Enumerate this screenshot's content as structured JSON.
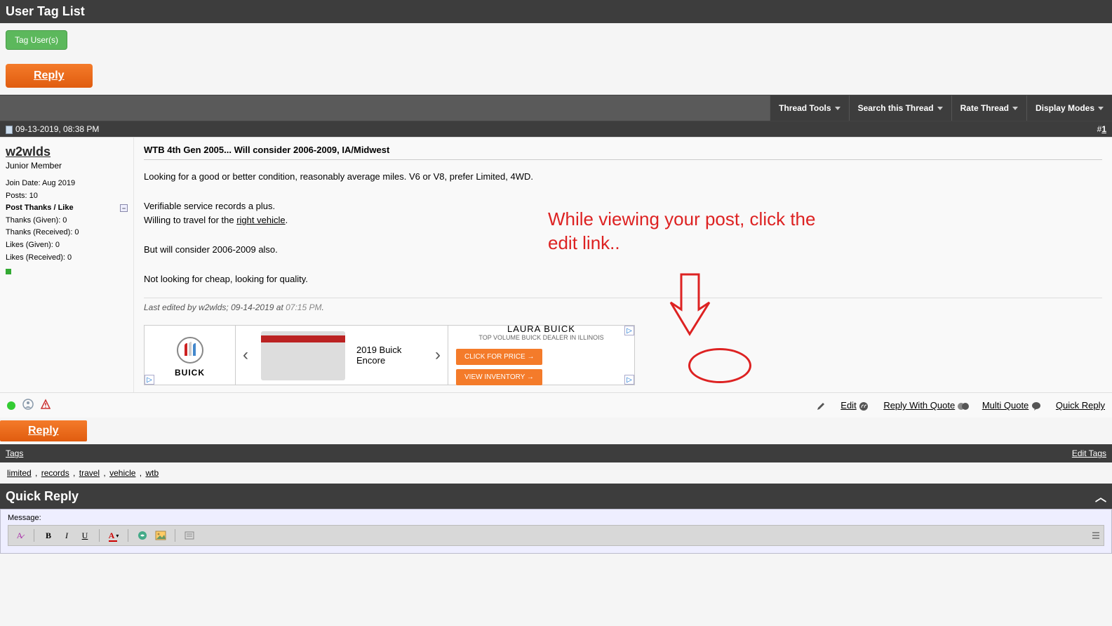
{
  "userTagList": {
    "title": "User Tag List",
    "tagBtn": "Tag User(s)"
  },
  "replyBtn": "Reply",
  "toolbar": {
    "threadTools": "Thread Tools",
    "searchThread": "Search this Thread",
    "rateThread": "Rate Thread",
    "displayModes": "Display Modes"
  },
  "post": {
    "datetime": "09-13-2019, 08:38 PM",
    "numPrefix": "#",
    "num": "1",
    "user": {
      "name": "w2wlds",
      "title": "Junior Member",
      "joinLabel": "Join Date: Aug 2019",
      "postsLabel": "Posts: 10",
      "ptl": "Post Thanks / Like",
      "thanksGiven": "Thanks (Given): 0",
      "thanksRecv": "Thanks (Received): 0",
      "likesGiven": "Likes (Given): 0",
      "likesRecv": "Likes (Received): 0"
    },
    "title": "WTB 4th Gen 2005... Will consider 2006-2009, IA/Midwest",
    "body1": "Looking for a good or better condition, reasonably average miles. V6 or V8, prefer Limited, 4WD.",
    "body2": "Verifiable service records a plus.",
    "body3a": "Willing to travel for the ",
    "body3link": "right vehicle",
    "body3b": ".",
    "body4": "But will consider 2006-2009 also.",
    "body5": "Not looking for cheap, looking for quality.",
    "editNoteA": "Last edited by w2wlds; 09-14-2019 at ",
    "editTime": "07:15 PM",
    "editNoteB": "."
  },
  "annotation": "While viewing your post, click the edit link..",
  "ad": {
    "brand": "BUICK",
    "model": "2019 Buick Encore",
    "dealer1": "LAURA BUICK",
    "dealer2": "TOP VOLUME BUICK DEALER IN ILLINOIS",
    "cta1": "CLICK FOR PRICE",
    "cta2": "VIEW INVENTORY"
  },
  "actions": {
    "edit": "Edit",
    "replyQuote": "Reply With Quote",
    "multiQuote": "Multi Quote",
    "quickReply": "Quick Reply"
  },
  "tags": {
    "header": "Tags",
    "editTags": "Edit Tags",
    "items": [
      "limited",
      "records",
      "travel",
      "vehicle",
      "wtb"
    ],
    "sep": " , "
  },
  "quickReply": {
    "title": "Quick Reply",
    "messageLabel": "Message:"
  }
}
